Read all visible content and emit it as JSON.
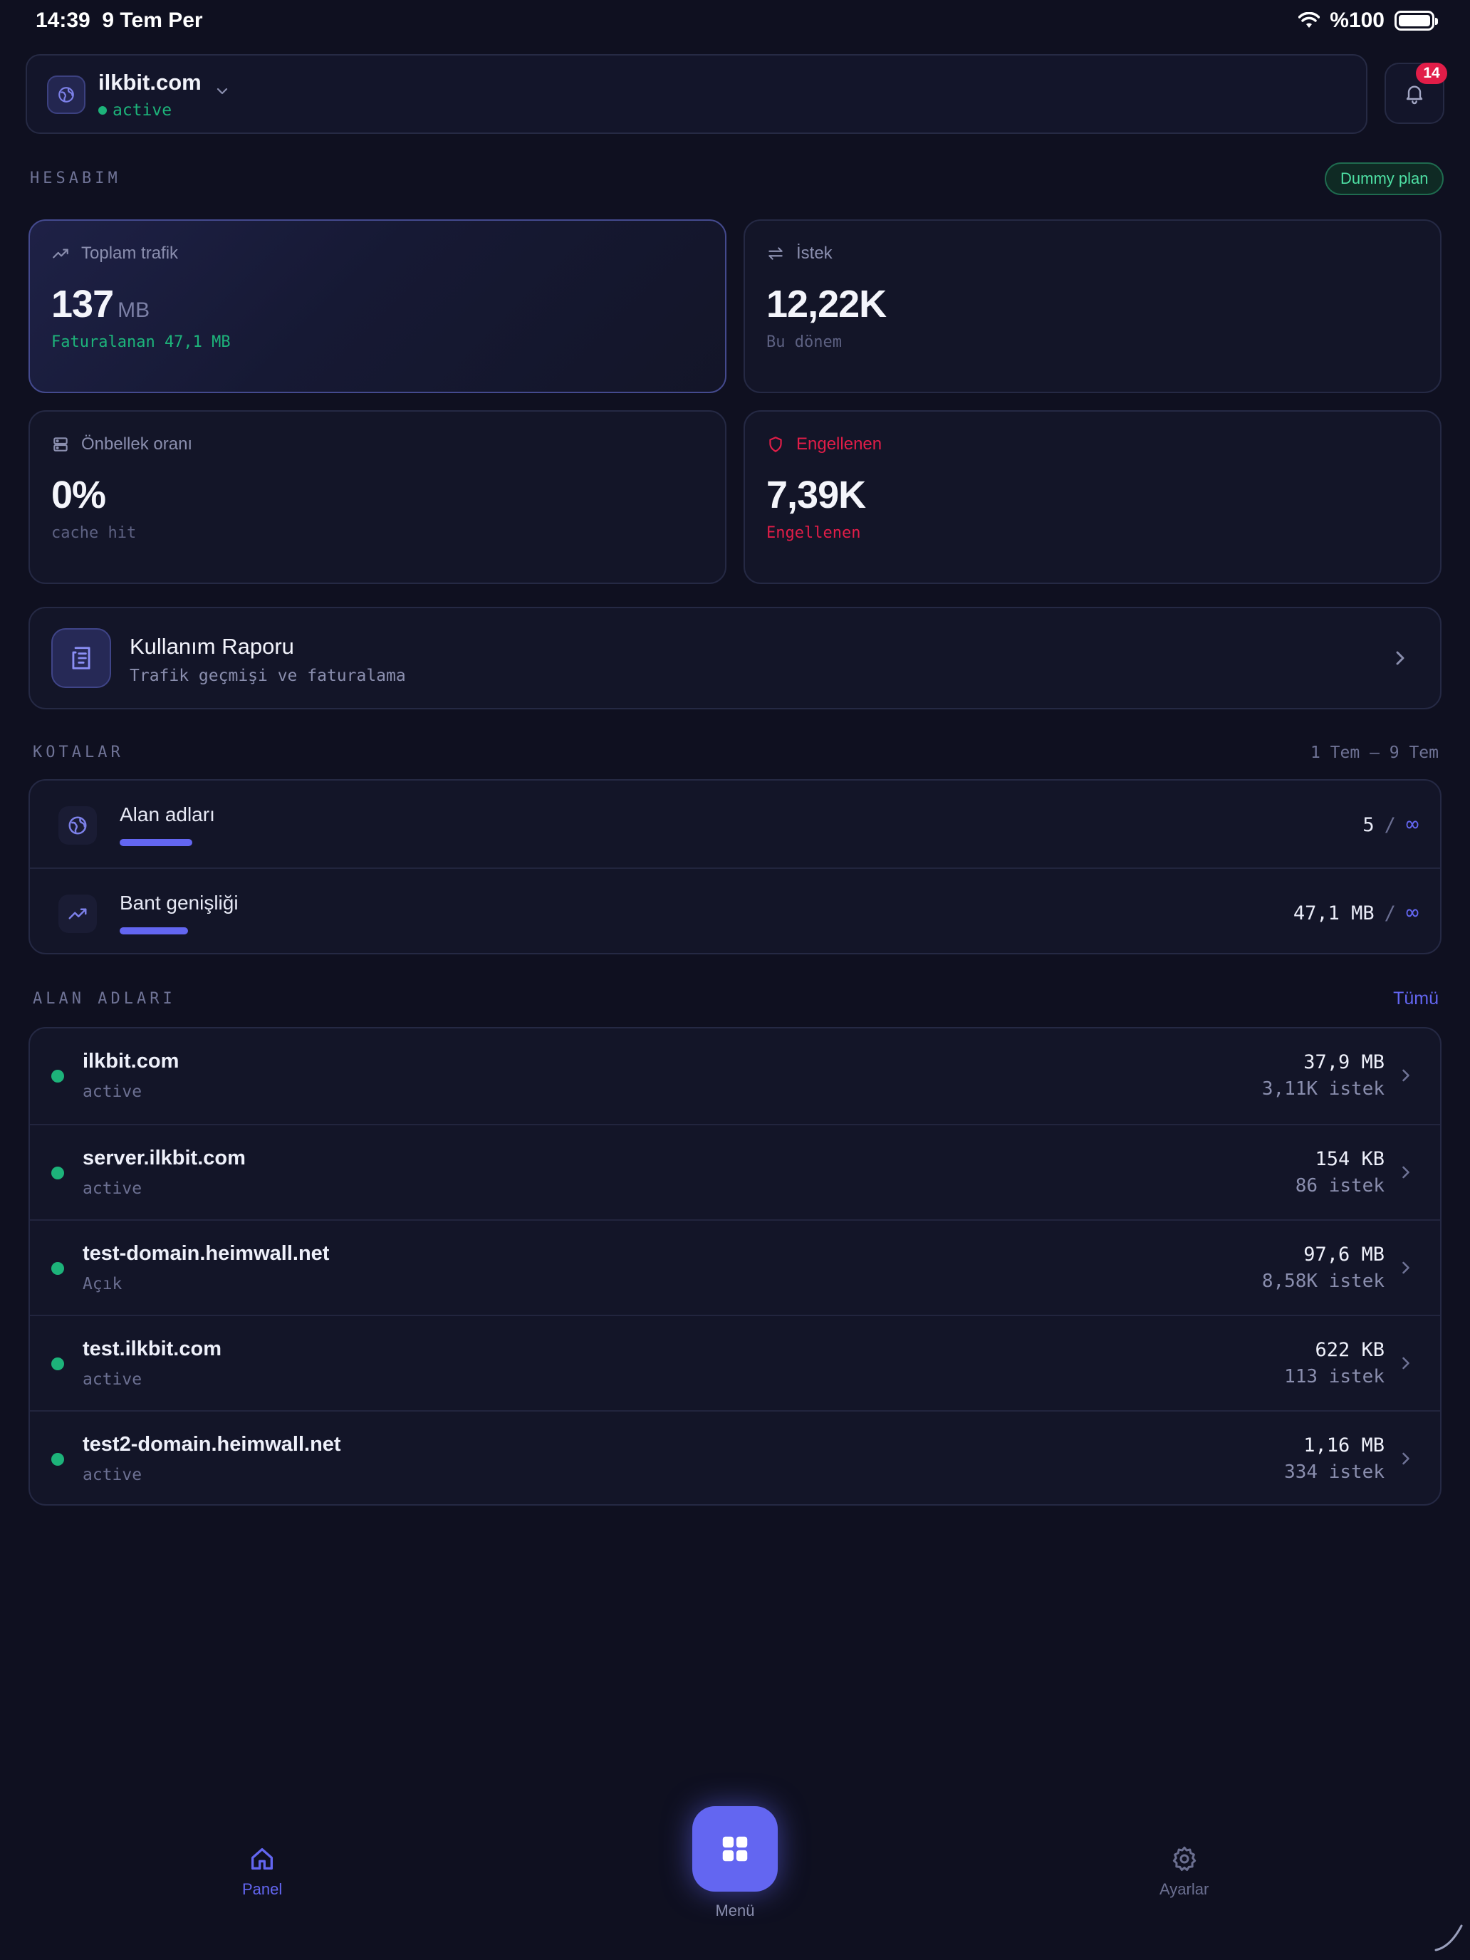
{
  "status_bar": {
    "time": "14:39",
    "date": "9 Tem Per",
    "battery": "%100"
  },
  "site": {
    "name": "ilkbit.com",
    "status": "active",
    "notifications": "14"
  },
  "account": {
    "section_label": "HESABIM",
    "plan": "Dummy plan",
    "cards": [
      {
        "label": "Toplam trafik",
        "value": "137",
        "unit": "MB",
        "sub": "Faturalanan 47,1 MB"
      },
      {
        "label": "İstek",
        "value": "12,22K",
        "sub": "Bu dönem"
      },
      {
        "label": "Önbellek oranı",
        "value": "0%",
        "sub": "cache hit"
      },
      {
        "label": "Engellenen",
        "value": "7,39K",
        "sub": "Engellenen"
      }
    ]
  },
  "report": {
    "title": "Kullanım Raporu",
    "subtitle": "Trafik geçmişi ve faturalama"
  },
  "quotas": {
    "section_label": "KOTALAR",
    "period": "1 Tem – 9 Tem",
    "items": [
      {
        "label": "Alan adları",
        "value": "5",
        "limit": "∞"
      },
      {
        "label": "Bant genişliği",
        "value": "47,1 MB",
        "limit": "∞"
      }
    ]
  },
  "domains": {
    "section_label": "ALAN ADLARI",
    "all_link": "Tümü",
    "items": [
      {
        "name": "ilkbit.com",
        "status": "active",
        "size": "37,9 MB",
        "requests": "3,11K istek"
      },
      {
        "name": "server.ilkbit.com",
        "status": "active",
        "size": "154 KB",
        "requests": "86 istek"
      },
      {
        "name": "test-domain.heimwall.net",
        "status": "Açık",
        "size": "97,6 MB",
        "requests": "8,58K istek"
      },
      {
        "name": "test.ilkbit.com",
        "status": "active",
        "size": "622 KB",
        "requests": "113 istek"
      },
      {
        "name": "test2-domain.heimwall.net",
        "status": "active",
        "size": "1,16 MB",
        "requests": "334 istek"
      }
    ]
  },
  "nav": {
    "panel": "Panel",
    "menu": "Menü",
    "settings": "Ayarlar"
  },
  "colors": {
    "accent": "#6366f1",
    "success": "#1db37a",
    "danger": "#e11d48",
    "background": "#0f1020"
  },
  "icons": [
    "globe-icon",
    "chevron-down-icon",
    "bell-icon",
    "trend-icon",
    "arrows-icon",
    "server-icon",
    "shield-icon",
    "report-icon",
    "chevron-right-icon",
    "home-icon",
    "grid-icon",
    "gear-icon"
  ]
}
